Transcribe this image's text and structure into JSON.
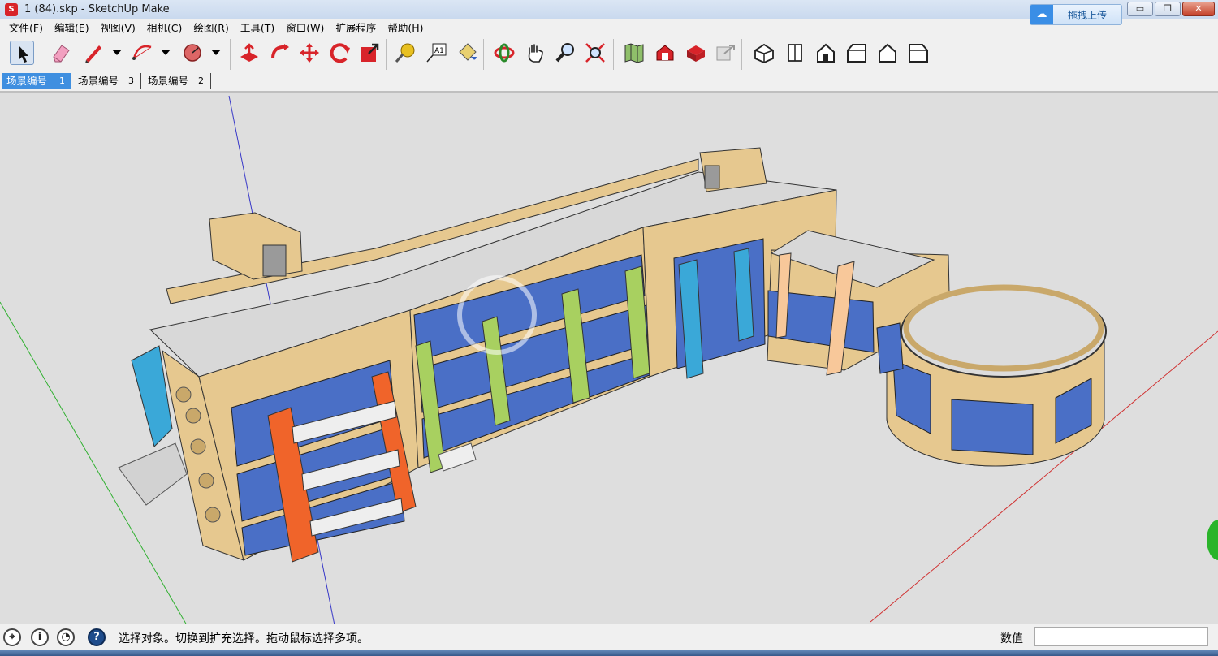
{
  "window": {
    "title": "1 (84).skp - SketchUp Make",
    "controls": {
      "minimize": "▭",
      "restore": "❐",
      "close": "✕"
    }
  },
  "menu": [
    "文件(F)",
    "编辑(E)",
    "视图(V)",
    "相机(C)",
    "绘图(R)",
    "工具(T)",
    "窗口(W)",
    "扩展程序",
    "帮助(H)"
  ],
  "upload_button": {
    "label": "拖拽上传",
    "icon": "cloud-upload-icon"
  },
  "toolbar": {
    "tools": [
      "select-tool-icon",
      "eraser-tool-icon",
      "pencil-line-tool-icon",
      "arc-tool-icon",
      "shape-tool-icon",
      "push-pull-tool-icon",
      "follow-me-tool-icon",
      "move-tool-icon",
      "rotate-tool-icon",
      "scale-tool-icon",
      "tape-measure-tool-icon",
      "text-tool-icon",
      "paint-bucket-tool-icon",
      "orbit-tool-icon",
      "pan-tool-icon",
      "zoom-tool-icon",
      "zoom-extents-tool-icon",
      "map-location-icon",
      "warehouse-icon",
      "extension-warehouse-icon",
      "share-model-icon",
      "iso-view-icon",
      "top-view-icon",
      "front-view-icon",
      "right-view-icon",
      "back-view-icon",
      "left-view-icon"
    ],
    "active_tool": "select-tool-icon"
  },
  "scenes": [
    {
      "label": "场景编号",
      "num": "1",
      "active": true
    },
    {
      "label": "场景编号",
      "num": "3",
      "active": false
    },
    {
      "label": "场景编号",
      "num": "2",
      "active": false
    }
  ],
  "colors": {
    "wall": "#e6c88f",
    "roof": "#d6d6d6",
    "glass": "#4a6fc6",
    "accent_orange": "#f0642a",
    "accent_green": "#a8d060",
    "accent_blue": "#3aa8d8",
    "accent_peach": "#f8c89a"
  },
  "status": {
    "icons": [
      "location-icon",
      "info-icon",
      "user-icon",
      "help-icon"
    ],
    "help_glyph": "?",
    "info_glyph": "i",
    "message": "选择对象。切换到扩充选择。拖动鼠标选择多项。",
    "measurement_label": "数值",
    "measurement_value": ""
  }
}
